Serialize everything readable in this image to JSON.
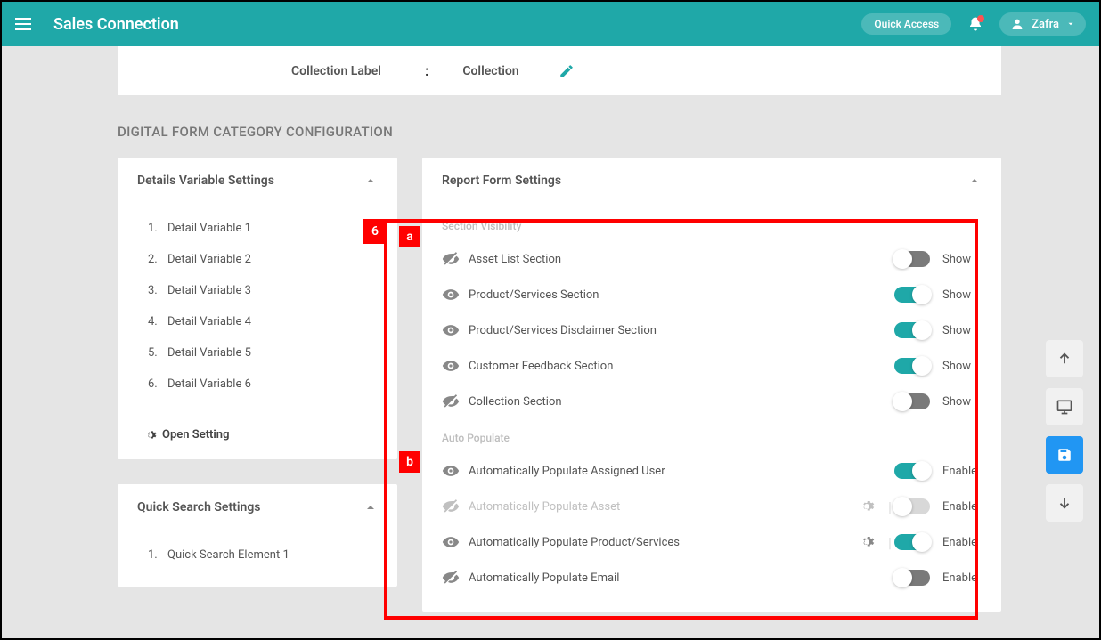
{
  "header": {
    "title": "Sales Connection",
    "quickAccess": "Quick Access",
    "user": "Zafra"
  },
  "collectionRow": {
    "label": "Collection Label",
    "value": "Collection"
  },
  "sectionTitle": "DIGITAL FORM CATEGORY CONFIGURATION",
  "detailsCard": {
    "title": "Details Variable Settings",
    "items": [
      {
        "num": "1.",
        "label": "Detail Variable 1"
      },
      {
        "num": "2.",
        "label": "Detail Variable 2"
      },
      {
        "num": "3.",
        "label": "Detail Variable 3"
      },
      {
        "num": "4.",
        "label": "Detail Variable 4"
      },
      {
        "num": "5.",
        "label": "Detail Variable 5"
      },
      {
        "num": "6.",
        "label": "Detail Variable 6"
      }
    ],
    "openSetting": "Open Setting"
  },
  "quickSearch": {
    "title": "Quick Search Settings",
    "items": [
      {
        "num": "1.",
        "label": "Quick Search Element 1"
      }
    ]
  },
  "reportCard": {
    "title": "Report Form Settings",
    "sectionA": {
      "heading": "Section Visibility",
      "rows": [
        {
          "label": "Asset List Section",
          "btnLabel": "Show",
          "on": false,
          "visible": false
        },
        {
          "label": "Product/Services Section",
          "btnLabel": "Show",
          "on": true,
          "visible": true
        },
        {
          "label": "Product/Services Disclaimer Section",
          "btnLabel": "Show",
          "on": true,
          "visible": true
        },
        {
          "label": "Customer Feedback Section",
          "btnLabel": "Show",
          "on": true,
          "visible": true
        },
        {
          "label": "Collection Section",
          "btnLabel": "Show",
          "on": false,
          "visible": false
        }
      ]
    },
    "sectionB": {
      "heading": "Auto Populate",
      "rows": [
        {
          "label": "Automatically Populate Assigned User",
          "btnLabel": "Enable",
          "on": true,
          "visible": true,
          "gear": false
        },
        {
          "label": "Automatically Populate Asset",
          "btnLabel": "Enable",
          "on": false,
          "visible": false,
          "disabled": true,
          "gear": true
        },
        {
          "label": "Automatically Populate Product/Services",
          "btnLabel": "Enable",
          "on": true,
          "visible": true,
          "gear": true
        },
        {
          "label": "Automatically Populate Email",
          "btnLabel": "Enable",
          "on": false,
          "visible": false,
          "gear": false
        }
      ]
    }
  },
  "annotations": {
    "main": "6",
    "a": "a",
    "b": "b"
  }
}
